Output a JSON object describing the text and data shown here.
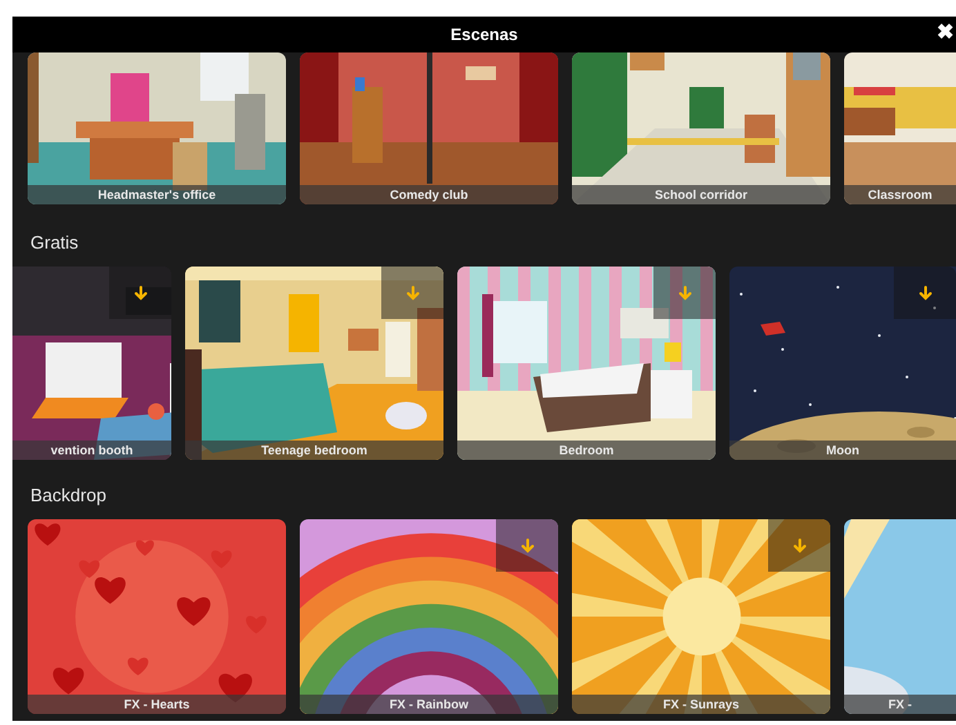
{
  "title": "Escenas",
  "close": "✖",
  "sections": [
    {
      "items": [
        {
          "label": "Headmaster's office",
          "downloadable": false
        },
        {
          "label": "Comedy club",
          "downloadable": false
        },
        {
          "label": "School corridor",
          "downloadable": false
        },
        {
          "label": "Classroom",
          "downloadable": false
        }
      ]
    },
    {
      "heading": "Gratis",
      "items": [
        {
          "label": "vention booth",
          "downloadable": true
        },
        {
          "label": "Teenage bedroom",
          "downloadable": true
        },
        {
          "label": "Bedroom",
          "downloadable": true
        },
        {
          "label": "Moon",
          "downloadable": true
        }
      ]
    },
    {
      "heading": "Backdrop",
      "items": [
        {
          "label": "FX - Hearts",
          "downloadable": false
        },
        {
          "label": "FX - Rainbow",
          "downloadable": true
        },
        {
          "label": "FX - Sunrays",
          "downloadable": true
        },
        {
          "label": "FX -",
          "downloadable": false
        }
      ]
    }
  ]
}
